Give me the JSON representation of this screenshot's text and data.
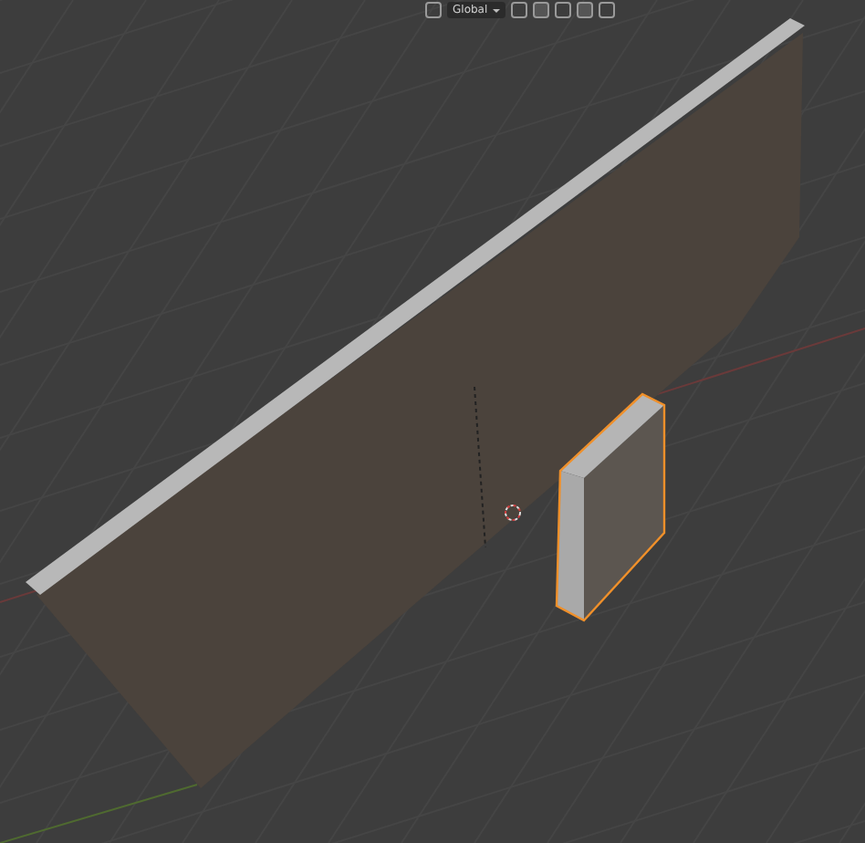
{
  "header": {
    "orientation": "Global"
  },
  "objects": [
    {
      "kind": "wall",
      "selected": false
    },
    {
      "kind": "block",
      "selected": true
    }
  ]
}
